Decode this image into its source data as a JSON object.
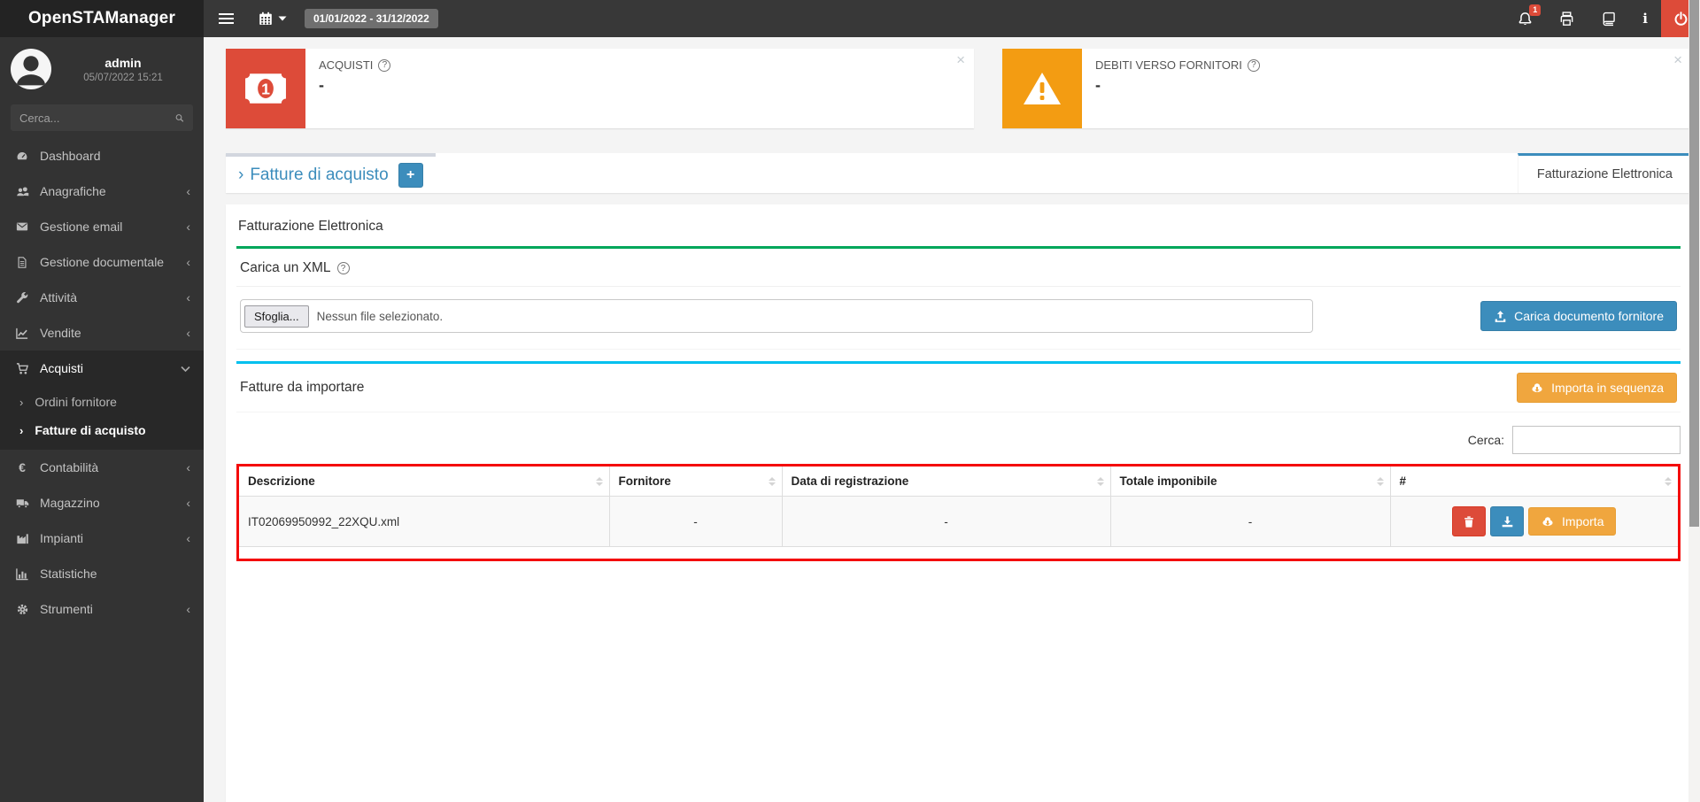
{
  "topbar": {
    "brand": "OpenSTAManager",
    "date_range": "01/01/2022 - 31/12/2022",
    "notification_count": "1",
    "icons": [
      "hamburger-icon",
      "calendar-icon",
      "bell-icon",
      "printer-icon",
      "book-icon",
      "info-icon",
      "power-icon"
    ]
  },
  "sidebar": {
    "user_name": "admin",
    "login_time": "05/07/2022 15:21",
    "search_placeholder": "Cerca...",
    "items": [
      {
        "label": "Dashboard",
        "icon": "dashboard-icon",
        "arrow": ""
      },
      {
        "label": "Anagrafiche",
        "icon": "users-icon",
        "arrow": "‹"
      },
      {
        "label": "Gestione email",
        "icon": "envelope-icon",
        "arrow": "‹"
      },
      {
        "label": "Gestione documentale",
        "icon": "document-icon",
        "arrow": "‹"
      },
      {
        "label": "Attività",
        "icon": "wrench-icon",
        "arrow": "‹"
      },
      {
        "label": "Vendite",
        "icon": "chart-line-icon",
        "arrow": "‹"
      },
      {
        "label": "Acquisti",
        "icon": "cart-icon",
        "arrow": "⌄",
        "expanded": true
      },
      {
        "label": "Contabilità",
        "icon": "euro-icon",
        "arrow": "‹"
      },
      {
        "label": "Magazzino",
        "icon": "truck-icon",
        "arrow": "‹"
      },
      {
        "label": "Impianti",
        "icon": "industry-icon",
        "arrow": "‹"
      },
      {
        "label": "Statistiche",
        "icon": "bar-chart-icon",
        "arrow": ""
      },
      {
        "label": "Strumenti",
        "icon": "gear-icon",
        "arrow": "‹"
      }
    ],
    "acquisti_submenu": [
      {
        "label": "Ordini fornitore",
        "active": false
      },
      {
        "label": "Fatture di acquisto",
        "active": true
      }
    ]
  },
  "info_boxes": [
    {
      "label": "ACQUISTI",
      "value": "-",
      "icon": "money-bill-icon",
      "color": "#dd4b39"
    },
    {
      "label": "DEBITI VERSO FORNITORI",
      "value": "-",
      "icon": "warning-triangle-icon",
      "color": "#f39c12"
    }
  ],
  "title_bar": {
    "title": "Fatture di acquisto",
    "add_button": "+",
    "tab": "Fatturazione Elettronica"
  },
  "panel": {
    "heading": "Fatturazione Elettronica",
    "upload": {
      "title": "Carica un XML",
      "browse_label": "Sfoglia...",
      "file_status": "Nessun file selezionato.",
      "submit_label": "Carica documento fornitore"
    },
    "import": {
      "title": "Fatture da importare",
      "sequence_button": "Importa in sequenza",
      "search_label": "Cerca:",
      "table": {
        "headers": [
          "Descrizione",
          "Fornitore",
          "Data di registrazione",
          "Totale imponibile",
          "#"
        ],
        "rows": [
          {
            "descrizione": "IT02069950992_22XQU.xml",
            "fornitore": "-",
            "data_registrazione": "-",
            "totale_imponibile": "-",
            "import_label": "Importa"
          }
        ]
      }
    }
  },
  "colors": {
    "primary_blue": "#3c8dbc",
    "success_green": "#00a65a",
    "info_cyan": "#00c0ef",
    "warning_orange": "#f0a63e",
    "danger_red": "#dd4b39",
    "table_border_red": "#f40b0b"
  }
}
